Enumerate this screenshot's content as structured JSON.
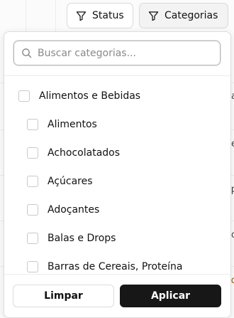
{
  "filters": {
    "status_label": "Status",
    "categories_label": "Categorias"
  },
  "search": {
    "placeholder": "Buscar categorias..."
  },
  "categories": [
    {
      "label": "Alimentos e Bebidas",
      "level": 0,
      "checked": false
    },
    {
      "label": "Alimentos",
      "level": 1,
      "checked": false
    },
    {
      "label": "Achocolatados",
      "level": 1,
      "checked": false
    },
    {
      "label": "Açúcares",
      "level": 1,
      "checked": false
    },
    {
      "label": "Adoçantes",
      "level": 1,
      "checked": false
    },
    {
      "label": "Balas e Drops",
      "level": 1,
      "checked": false
    },
    {
      "label": "Barras de Cereais, Proteína",
      "level": 1,
      "checked": false
    }
  ],
  "footer": {
    "clear_label": "Limpar",
    "apply_label": "Aplicar"
  },
  "background_fragments": [
    "a",
    "e",
    "p",
    "o",
    "d"
  ],
  "colors": {
    "primary_button": "#171717",
    "border": "#dedede",
    "background_accent": "#a05a00"
  }
}
